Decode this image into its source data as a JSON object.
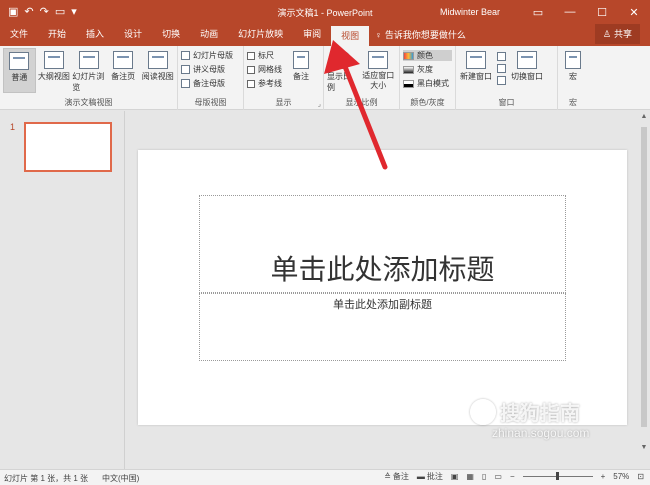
{
  "titlebar": {
    "doc_title": "演示文稿1 - PowerPoint",
    "user": "Midwinter Bear",
    "qat_icons": [
      "save-icon",
      "undo-icon",
      "redo-icon",
      "present-icon",
      "customize-icon"
    ]
  },
  "tabs": [
    "文件",
    "开始",
    "插入",
    "设计",
    "切换",
    "动画",
    "幻灯片放映",
    "审阅",
    "视图"
  ],
  "active_tab": "视图",
  "tell_me": "告诉我你想要做什么",
  "share": "共享",
  "ribbon": {
    "presentation_views": {
      "label": "演示文稿视图",
      "buttons": [
        "普通",
        "大纲视图",
        "幻灯片浏览",
        "备注页",
        "阅读视图"
      ]
    },
    "master_views": {
      "label": "母版视图",
      "items": [
        "幻灯片母版",
        "讲义母版",
        "备注母版"
      ]
    },
    "show": {
      "label": "显示",
      "items": [
        "标尺",
        "网格线",
        "参考线"
      ],
      "notes": "备注"
    },
    "zoom": {
      "label": "显示比例",
      "zoom_btn": "显示比例",
      "fit_btn": "适应窗口大小"
    },
    "color": {
      "label": "颜色/灰度",
      "items": [
        "颜色",
        "灰度",
        "黑白模式"
      ]
    },
    "window": {
      "label": "窗口",
      "new_window": "新建窗口",
      "switch_window": "切换窗口"
    },
    "macros": {
      "label": "宏",
      "btn": "宏"
    }
  },
  "thumbnails": {
    "slide_number": "1"
  },
  "slide": {
    "title_placeholder": "单击此处添加标题",
    "subtitle_placeholder": "单击此处添加副标题"
  },
  "statusbar": {
    "slide_info": "幻灯片 第 1 张，共 1 张",
    "language": "中文(中国)",
    "notes": "备注",
    "comments": "批注",
    "zoom": "57%"
  },
  "watermark": {
    "text": "搜狗指南",
    "url": "zhinan.sogou.com"
  },
  "colors": {
    "accent": "#b7472a",
    "annotation_arrow": "#e0282e"
  }
}
